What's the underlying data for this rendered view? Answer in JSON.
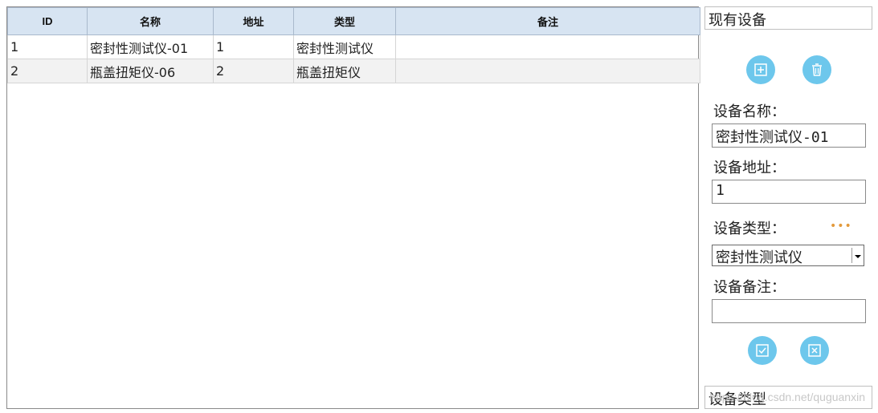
{
  "table": {
    "headers": [
      "ID",
      "名称",
      "地址",
      "类型",
      "备注"
    ],
    "rows": [
      [
        "1",
        "密封性测试仪-01",
        "1",
        "密封性测试仪",
        ""
      ],
      [
        "2",
        "瓶盖扭矩仪-06",
        "2",
        "瓶盖扭矩仪",
        ""
      ]
    ]
  },
  "panel": {
    "title": "现有设备",
    "name_label": "设备名称：",
    "name_value": "密封性测试仪-01",
    "address_label": "设备地址：",
    "address_value": "1",
    "type_label": "设备类型：",
    "type_more": "•••",
    "type_selected": "密封性测试仪",
    "note_label": "设备备注：",
    "note_value": "",
    "footer": "设备类型"
  },
  "watermark": "https://blog.csdn.net/quguanxin",
  "colors": {
    "header_bg": "#d7e4f2",
    "button": "#6dc7ec",
    "more_dots": "#e39a3c"
  },
  "icons": [
    "add-icon",
    "delete-icon",
    "confirm-icon",
    "cancel-icon"
  ]
}
